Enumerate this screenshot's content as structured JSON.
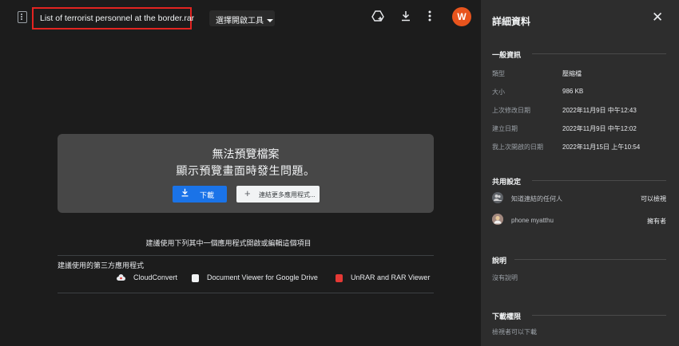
{
  "viewer": {
    "file_name": "List of terrorist personnel at the border.rar",
    "open_with_label": "選擇開啟工具",
    "avatar_letter": "W",
    "error": {
      "title": "無法預覽檔案",
      "subtitle": "顯示預覽畫面時發生問題。",
      "download_label": "下載",
      "connect_label": "連結更多應用程式..."
    },
    "suggest_heading": "建議使用下列其中一個應用程式開啟或編輯這個項目",
    "third_party_label": "建議使用的第三方應用程式",
    "apps": [
      {
        "name": "CloudConvert",
        "color": "#e8eaed"
      },
      {
        "name": "Document Viewer for Google Drive",
        "color": "#f1f3f4"
      },
      {
        "name": "UnRAR and RAR Viewer",
        "color": "#e53935"
      }
    ]
  },
  "details": {
    "title": "詳細資料",
    "general": {
      "heading": "一般資訊",
      "rows": [
        {
          "key": "類型",
          "value": "壓縮檔"
        },
        {
          "key": "大小",
          "value": "986 KB"
        },
        {
          "key": "上次修改日期",
          "value": "2022年11月9日 中午12:43"
        },
        {
          "key": "建立日期",
          "value": "2022年11月9日 中午12:02"
        },
        {
          "key": "我上次開啟的日期",
          "value": "2022年11月15日 上午10:54"
        }
      ]
    },
    "sharing": {
      "heading": "共用設定",
      "entries": [
        {
          "name": "知道連結的任何人",
          "role": "可以檢視"
        },
        {
          "name": "phone myatthu",
          "role": "擁有者"
        }
      ]
    },
    "description": {
      "heading": "說明",
      "text": "沒有說明"
    },
    "download": {
      "heading": "下載權限",
      "text": "檢視者可以下載"
    }
  }
}
